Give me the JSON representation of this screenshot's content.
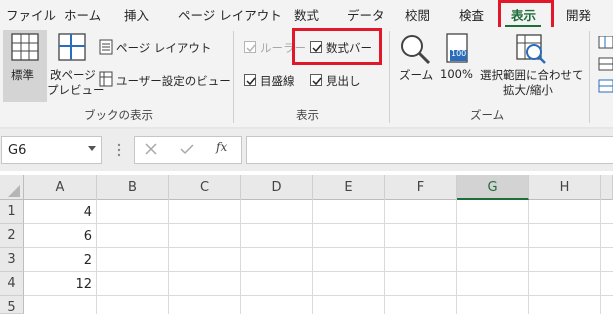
{
  "tabs": [
    {
      "label": "ファイル"
    },
    {
      "label": "ホーム"
    },
    {
      "label": "挿入"
    },
    {
      "label": "ページ レイアウト"
    },
    {
      "label": "数式"
    },
    {
      "label": "データ"
    },
    {
      "label": "校閲"
    },
    {
      "label": "検査"
    },
    {
      "label": "表示",
      "active": true
    },
    {
      "label": "開発"
    }
  ],
  "ribbon": {
    "workbook_views": {
      "normal": "標準",
      "page_break_line1": "改ページ",
      "page_break_line2": "プレビュー",
      "page_layout": "ページ レイアウト",
      "custom_views": "ユーザー設定のビュー",
      "group_label": "ブックの表示"
    },
    "show": {
      "ruler": {
        "label": "ルーラー",
        "checked": true,
        "disabled": true
      },
      "formula_bar": {
        "label": "数式バー",
        "checked": true
      },
      "gridlines": {
        "label": "目盛線",
        "checked": true
      },
      "headings": {
        "label": "見出し",
        "checked": true
      },
      "group_label": "表示"
    },
    "zoom": {
      "zoom": "ズーム",
      "zoom_100": "100%",
      "zoom_100_icon": "100",
      "zoom_selection_line1": "選択範囲に合わせて",
      "zoom_selection_line2": "拡大/縮小",
      "group_label": "ズーム"
    }
  },
  "formula_bar": {
    "name_box": "G6",
    "fx": "fx",
    "value": ""
  },
  "sheet": {
    "columns": [
      "A",
      "B",
      "C",
      "D",
      "E",
      "F",
      "G",
      "H"
    ],
    "selected_column": "G",
    "rows": [
      {
        "num": "1",
        "A": "4"
      },
      {
        "num": "2",
        "A": "6"
      },
      {
        "num": "3",
        "A": "2"
      },
      {
        "num": "4",
        "A": "12"
      },
      {
        "num": "5",
        "A": ""
      }
    ]
  },
  "colors": {
    "accent": "#1e6e3a",
    "highlight": "#e0182a"
  }
}
